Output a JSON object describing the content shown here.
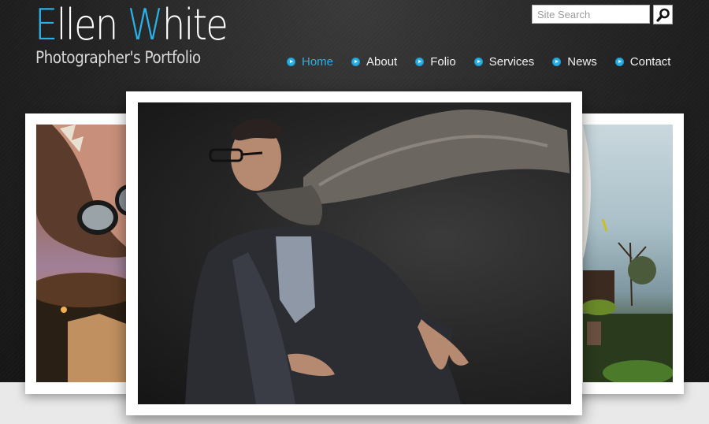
{
  "logo": {
    "title_part1": "Ellen ",
    "title_accent_letter": "W",
    "title_part2": "hite",
    "subtitle": "Photographer's Portfolio"
  },
  "search": {
    "placeholder": "Site Search",
    "value": ""
  },
  "nav": {
    "items": [
      {
        "label": "Home",
        "active": true
      },
      {
        "label": "About",
        "active": false
      },
      {
        "label": "Folio",
        "active": false
      },
      {
        "label": "Services",
        "active": false
      },
      {
        "label": "News",
        "active": false
      },
      {
        "label": "Contact",
        "active": false
      }
    ]
  },
  "colors": {
    "accent": "#2ab0e6",
    "header_bg": "#1f1f1f",
    "page_bg": "#e9e9e9",
    "frame": "#ffffff"
  },
  "icons": {
    "search": "magnifier-icon",
    "nav_bullet": "arrow-bullet-icon"
  },
  "slider": {
    "slides": [
      {
        "subject": "woman-sunglasses-dusk-photo"
      },
      {
        "subject": "man-glasses-scarf-photo"
      },
      {
        "subject": "woman-trees-sky-photo"
      }
    ]
  }
}
